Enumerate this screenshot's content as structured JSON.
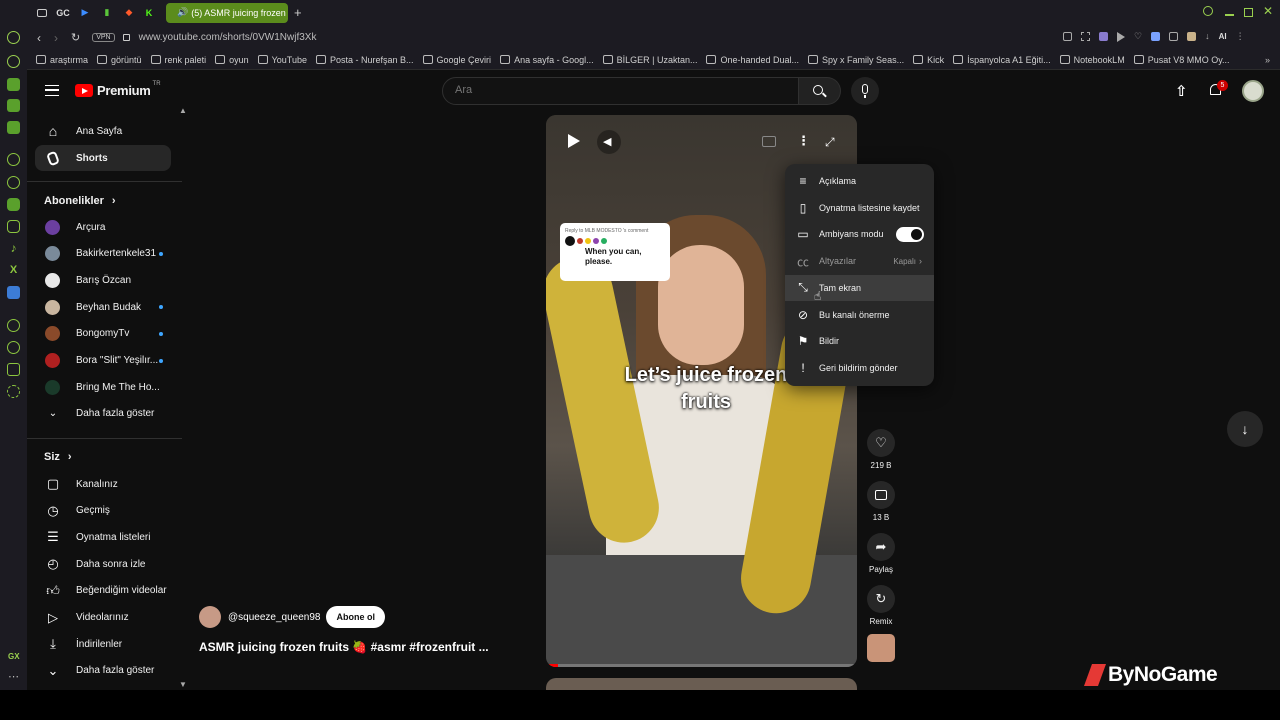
{
  "browser": {
    "tabs": [
      "GC"
    ],
    "active_tab_title": "(5) ASMR juicing frozen",
    "url": "www.youtube.com/shorts/0VW1Nwjf3Xk",
    "vpn_label": "VPN",
    "ai_label": "AI",
    "gx_label": "GX",
    "bookmarks": [
      "araştırma",
      "görüntü",
      "renk paleti",
      "oyun",
      "YouTube",
      "Posta - Nurefşan B...",
      "Google Çeviri",
      "Ana sayfa - Googl...",
      "BİLGER | Uzaktan...",
      "One-handed Dual...",
      "Spy x Family Seas...",
      "Kick",
      "İspanyolca A1 Eğiti...",
      "NotebookLM",
      "Pusat V8 MMO Oy..."
    ]
  },
  "masthead": {
    "logo_text": "Premium",
    "logo_region": "TR",
    "search_placeholder": "Ara",
    "notification_count": "5"
  },
  "sidebar": {
    "main": [
      {
        "label": "Ana Sayfa",
        "icon": "home-icon"
      },
      {
        "label": "Shorts",
        "icon": "shorts-icon"
      }
    ],
    "subscriptions_title": "Abonelikler",
    "subscriptions": [
      {
        "label": "Arçura",
        "color": "#6b3fa0",
        "dot": false
      },
      {
        "label": "Bakirkertenkele31",
        "color": "#7a8a9a",
        "dot": true
      },
      {
        "label": "Barış Özcan",
        "color": "#e8e8e8",
        "dot": false
      },
      {
        "label": "Beyhan Budak",
        "color": "#c9b6a0",
        "dot": true
      },
      {
        "label": "BongomyTv",
        "color": "#8a4a2a",
        "dot": true
      },
      {
        "label": "Bora \"Slit\" Yeşilır...",
        "color": "#b02020",
        "dot": true
      },
      {
        "label": "Bring Me The Ho...",
        "color": "#1a3a2a",
        "dot": false
      }
    ],
    "show_more": "Daha fazla göster",
    "you_title": "Siz",
    "you_items": [
      {
        "label": "Kanalınız",
        "icon": "account-icon"
      },
      {
        "label": "Geçmiş",
        "icon": "history-icon"
      },
      {
        "label": "Oynatma listeleri",
        "icon": "playlists-icon"
      },
      {
        "label": "Daha sonra izle",
        "icon": "watch-later-icon"
      },
      {
        "label": "Beğendiğim videolar",
        "icon": "liked-icon"
      },
      {
        "label": "Videolarınız",
        "icon": "your-videos-icon"
      },
      {
        "label": "İndirilenler",
        "icon": "downloads-icon"
      },
      {
        "label": "Daha fazla göster",
        "icon": "chevron-down-icon"
      }
    ]
  },
  "short": {
    "caption": "Let’s juice frozen fruits",
    "comment_reply_to": "Reply to MLB MODESTO 's comment",
    "comment_text": "When you can, please.",
    "channel": "@squeeze_queen98",
    "subscribe_label": "Abone ol",
    "title": "ASMR juicing frozen fruits 🍓 #asmr #frozenfruit ...",
    "likes": "219 B",
    "comments": "13 B",
    "share_label": "Paylaş",
    "remix_label": "Remix"
  },
  "menu": {
    "items": [
      {
        "label": "Açıklama",
        "icon": "description-icon"
      },
      {
        "label": "Oynatma listesine kaydet",
        "icon": "bookmark-icon"
      },
      {
        "label": "Ambiyans modu",
        "icon": "ambient-icon",
        "toggle": true
      },
      {
        "label": "Altyazılar",
        "icon": "cc-icon",
        "value": "Kapalı"
      },
      {
        "label": "Tam ekran",
        "icon": "fullscreen-icon"
      },
      {
        "label": "Bu kanalı önerme",
        "icon": "block-icon"
      },
      {
        "label": "Bildir",
        "icon": "flag-icon"
      },
      {
        "label": "Geri bildirim gönder",
        "icon": "feedback-icon"
      }
    ]
  },
  "watermark": "ByNoGame"
}
